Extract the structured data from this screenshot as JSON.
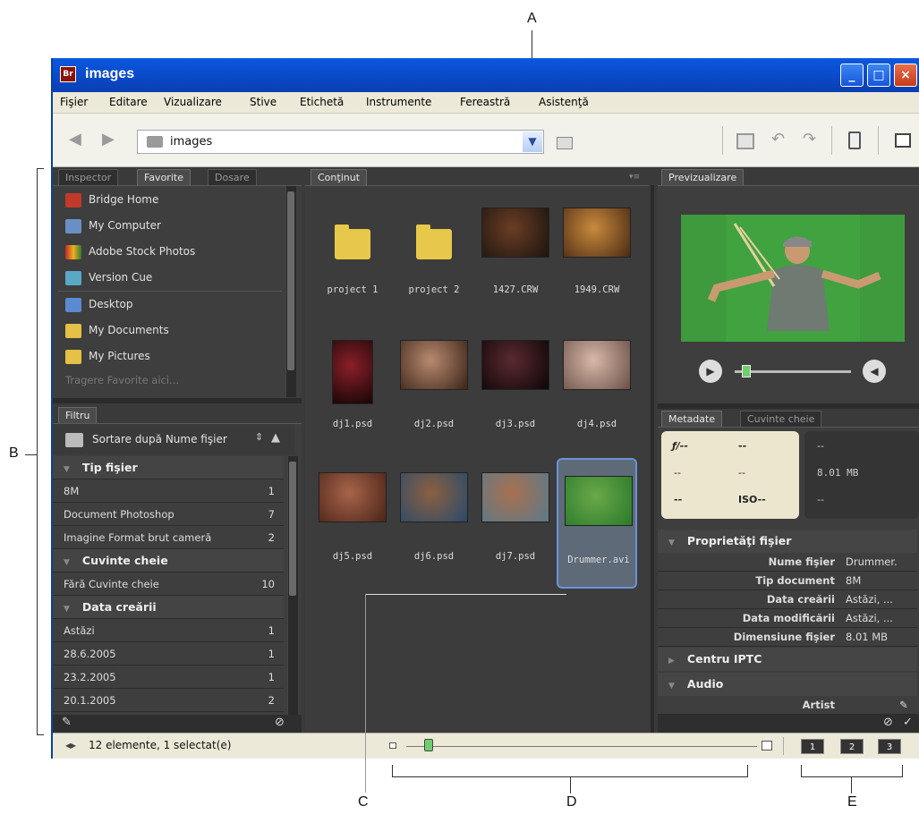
{
  "callouts": {
    "a": "A",
    "b": "B",
    "c": "C",
    "d": "D",
    "e": "E"
  },
  "window": {
    "title": "images",
    "app_icon": "Br",
    "minimize": "_",
    "maximize": "□",
    "close": "×"
  },
  "menu": [
    "Fişier",
    "Editare",
    "Vizualizare",
    "Stive",
    "Etichetă",
    "Instrumente",
    "Fereastră",
    "Asistenţă"
  ],
  "toolbar": {
    "path": "images",
    "icons": [
      "back-arrow-icon",
      "forward-arrow-icon",
      "folder-up-icon",
      "new-folder-icon",
      "rotate-left-icon",
      "rotate-right-icon",
      "trash-icon",
      "compact-mode-icon"
    ]
  },
  "left_panel": {
    "tabs": [
      "Inspector",
      "Favorite",
      "Dosare"
    ],
    "favorites": [
      {
        "label": "Bridge Home",
        "color": "#c0392b"
      },
      {
        "label": "My Computer",
        "color": "#6a8fc7"
      },
      {
        "label": "Adobe Stock Photos",
        "color": "#d4a020"
      },
      {
        "label": "Version Cue",
        "color": "#5aa8c8"
      },
      {
        "label": "Desktop",
        "color": "#5a8ad0"
      },
      {
        "label": "My Documents",
        "color": "#e3c245"
      },
      {
        "label": "My Pictures",
        "color": "#e3c245"
      }
    ],
    "drag_hint": "Tragere Favorite aici...",
    "filter_tab": "Filtru",
    "sort_label": "Sortare după Nume fişier",
    "filter_sections": [
      {
        "title": "Tip fişier",
        "rows": [
          {
            "label": "8M",
            "count": "1"
          },
          {
            "label": "Document Photoshop",
            "count": "7"
          },
          {
            "label": "Imagine Format brut cameră",
            "count": "2"
          }
        ]
      },
      {
        "title": "Cuvinte cheie",
        "rows": [
          {
            "label": "Fără Cuvinte cheie",
            "count": "10"
          }
        ]
      },
      {
        "title": "Data creării",
        "rows": [
          {
            "label": "Astăzi",
            "count": "1"
          },
          {
            "label": "28.6.2005",
            "count": "1"
          },
          {
            "label": "23.2.2005",
            "count": "1"
          },
          {
            "label": "20.1.2005",
            "count": "2"
          }
        ]
      }
    ]
  },
  "content": {
    "tab": "Conţinut",
    "items": [
      {
        "name": "project 1",
        "kind": "folder"
      },
      {
        "name": "project 2",
        "kind": "folder"
      },
      {
        "name": "1427.CRW",
        "kind": "image",
        "c1": "#6b3d24",
        "c2": "#1b1410"
      },
      {
        "name": "1949.CRW",
        "kind": "image",
        "c1": "#c98a3c",
        "c2": "#4a2a14"
      },
      {
        "name": "dj1.psd",
        "kind": "image",
        "c1": "#8a1f28",
        "c2": "#160606"
      },
      {
        "name": "dj2.psd",
        "kind": "image",
        "c1": "#b88a70",
        "c2": "#3b2418"
      },
      {
        "name": "dj3.psd",
        "kind": "image",
        "c1": "#5a2a30",
        "c2": "#0c0506"
      },
      {
        "name": "dj4.psd",
        "kind": "image",
        "c1": "#d8b8a8",
        "c2": "#6a5048"
      },
      {
        "name": "dj5.psd",
        "kind": "image",
        "c1": "#a8644a",
        "c2": "#4a2418"
      },
      {
        "name": "dj6.psd",
        "kind": "image",
        "c1": "#8a6040",
        "c2": "#2a4a6a"
      },
      {
        "name": "dj7.psd",
        "kind": "image",
        "c1": "#a87050",
        "c2": "#5a7a8a"
      },
      {
        "name": "Drummer.avi",
        "kind": "image",
        "c1": "#6aa84a",
        "c2": "#2a7a2a"
      }
    ]
  },
  "preview": {
    "tab": "Previzualizare"
  },
  "metadata": {
    "tabs": [
      "Metadate",
      "Cuvinte cheie"
    ],
    "camera": {
      "aperture": "ƒ/--",
      "shutter": "--",
      "r2a": "--",
      "r2b": "--",
      "r3a": "--",
      "iso": "ISO--"
    },
    "file": {
      "a": "--",
      "size": "8.01 MB",
      "b": "--"
    },
    "sections": {
      "file_props": "Proprietăţi fişier",
      "rows": [
        {
          "k": "Nume fişier",
          "v": "Drummer."
        },
        {
          "k": "Tip document",
          "v": "8M"
        },
        {
          "k": "Data creării",
          "v": "Astăzi, ..."
        },
        {
          "k": "Data modificării",
          "v": "Astăzi, ..."
        },
        {
          "k": "Dimensiune fişier",
          "v": "8.01 MB"
        }
      ],
      "iptc": "Centru IPTC",
      "audio": "Audio",
      "artist": "Artist"
    }
  },
  "statusbar": {
    "text": "12 elemente, 1 selectat(e)",
    "zoom": 0.05,
    "view_buttons": [
      "1",
      "2",
      "3"
    ]
  }
}
